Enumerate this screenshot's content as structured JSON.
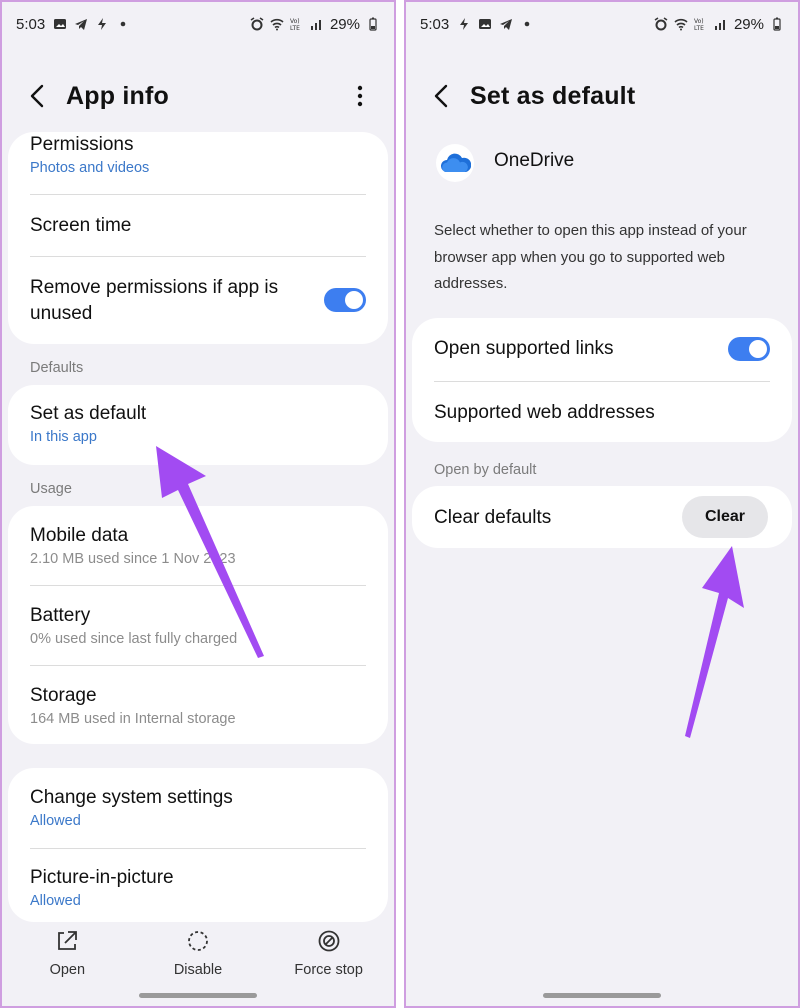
{
  "left": {
    "status": {
      "time": "5:03",
      "battery": "29%"
    },
    "title": "App info",
    "permissions": {
      "label": "Permissions",
      "value": "Photos and videos"
    },
    "screen_time": {
      "label": "Screen time"
    },
    "remove_permissions": {
      "label_line1": "Remove permissions if app is",
      "label_line2": "unused",
      "enabled": true
    },
    "defaults_header": "Defaults",
    "set_as_default": {
      "label": "Set as default",
      "value": "In this app"
    },
    "usage_header": "Usage",
    "mobile_data": {
      "label": "Mobile data",
      "value": "2.10 MB used since 1 Nov 2023"
    },
    "battery": {
      "label": "Battery",
      "value": "0% used since last fully charged"
    },
    "storage": {
      "label": "Storage",
      "value": "164 MB used in Internal storage"
    },
    "change_system_settings": {
      "label": "Change system settings",
      "value": "Allowed"
    },
    "picture_in_picture": {
      "label": "Picture-in-picture",
      "value": "Allowed"
    },
    "bottom_nav": {
      "open": "Open",
      "disable": "Disable",
      "force_stop": "Force stop"
    }
  },
  "right": {
    "status": {
      "time": "5:03",
      "battery": "29%"
    },
    "title": "Set as default",
    "app_name": "OneDrive",
    "description": "Select whether to open this app instead of your browser app when you go to supported web addresses.",
    "open_supported_links": {
      "label": "Open supported links",
      "enabled": true
    },
    "supported_web_addresses": {
      "label": "Supported web addresses"
    },
    "open_by_default_header": "Open by default",
    "clear_defaults": {
      "label": "Clear defaults",
      "button": "Clear"
    }
  },
  "colors": {
    "accent_blue": "#3d7ef0",
    "link_blue": "#3b78c9",
    "annotation_arrow": "#a24bf2",
    "background": "#f2f1f6"
  },
  "icons": [
    "back-arrow-icon",
    "more-vertical-icon",
    "open-icon",
    "disable-icon",
    "force-stop-icon",
    "onedrive-cloud-icon"
  ]
}
